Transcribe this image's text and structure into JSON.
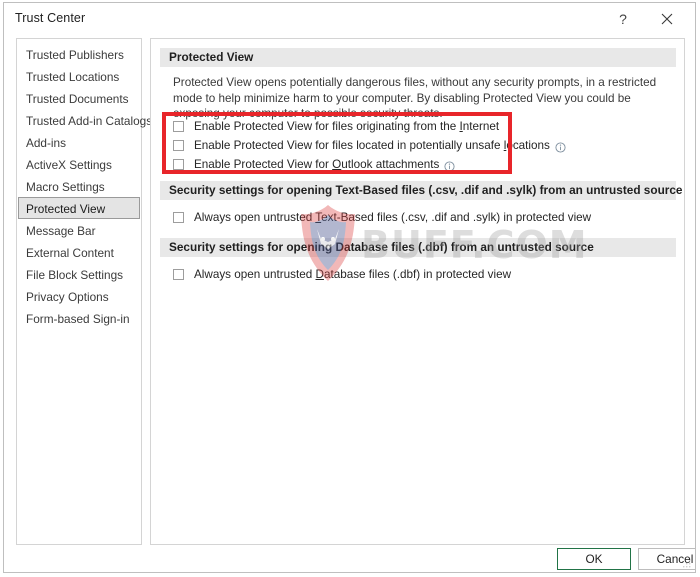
{
  "window": {
    "title": "Trust Center",
    "help_label": "?",
    "close_label": "✕"
  },
  "sidebar": {
    "items": [
      {
        "label": "Trusted Publishers",
        "selected": false
      },
      {
        "label": "Trusted Locations",
        "selected": false
      },
      {
        "label": "Trusted Documents",
        "selected": false
      },
      {
        "label": "Trusted Add-in Catalogs",
        "selected": false
      },
      {
        "label": "Add-ins",
        "selected": false
      },
      {
        "label": "ActiveX Settings",
        "selected": false
      },
      {
        "label": "Macro Settings",
        "selected": false
      },
      {
        "label": "Protected View",
        "selected": true
      },
      {
        "label": "Message Bar",
        "selected": false
      },
      {
        "label": "External Content",
        "selected": false
      },
      {
        "label": "File Block Settings",
        "selected": false
      },
      {
        "label": "Privacy Options",
        "selected": false
      },
      {
        "label": "Form-based Sign-in",
        "selected": false
      }
    ]
  },
  "main": {
    "section_protected_view": {
      "heading": "Protected View",
      "description": "Protected View opens potentially dangerous files, without any security prompts, in a restricted mode to help minimize harm to your computer. By disabling Protected View you could be exposing your computer to possible security threats.",
      "checkboxes": [
        {
          "pre": "Enable Protected View for files originating from the ",
          "accel": "I",
          "post": "nternet",
          "checked": false,
          "has_info": false
        },
        {
          "pre": "Enable Protected View for files located in potentially unsafe ",
          "accel": "l",
          "post": "ocations",
          "checked": false,
          "has_info": true
        },
        {
          "pre": "Enable Protected View for ",
          "accel": "O",
          "post": "utlook attachments",
          "checked": false,
          "has_info": true
        }
      ]
    },
    "section_text_based": {
      "heading": "Security settings for opening Text-Based files (.csv, .dif and .sylk) from an untrusted source",
      "checkbox": {
        "pre": "Always open untrusted ",
        "accel": "T",
        "post": "ext-Based files (.csv, .dif and .sylk) in protected view",
        "checked": false,
        "has_info": false
      }
    },
    "section_database": {
      "heading": "Security settings for opening Database files (.dbf) from an untrusted source",
      "checkbox": {
        "pre": "Always open untrusted ",
        "accel": "D",
        "post": "atabase files (.dbf) in protected view",
        "checked": false,
        "has_info": false
      }
    }
  },
  "annotation": {
    "type": "red-rectangle-highlight",
    "color": "#e8252a"
  },
  "watermark": {
    "text": "BUFF.COM",
    "logo": "bull-shield-logo"
  },
  "footer": {
    "ok_label": "OK",
    "cancel_label": "Cancel"
  },
  "colors": {
    "accent_ok_border": "#217346",
    "section_header_bg": "#e8e8e8",
    "selected_item_bg": "#e4e4e4",
    "annotation_red": "#e8252a"
  }
}
